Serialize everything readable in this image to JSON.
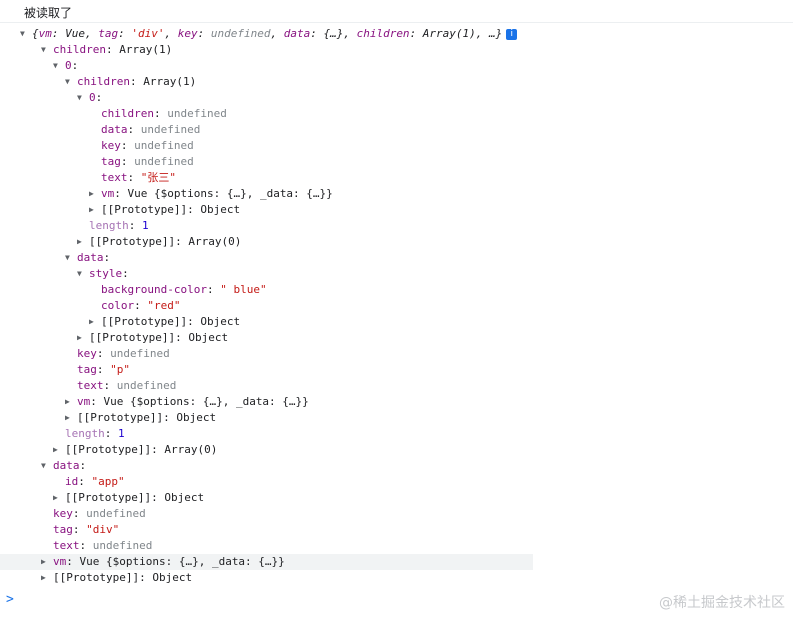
{
  "log_message": "被读取了",
  "watermark": "@稀土掘金技术社区",
  "prompt_symbol": ">",
  "rows": [
    {
      "id": "root",
      "indent": 32,
      "tri": "▼",
      "parts": [
        {
          "t": "{",
          "c": "p it"
        },
        {
          "t": "vm",
          "c": "k it"
        },
        {
          "t": ": Vue, ",
          "c": "p it"
        },
        {
          "t": "tag",
          "c": "k it"
        },
        {
          "t": ": ",
          "c": "p it"
        },
        {
          "t": "'div'",
          "c": "s it"
        },
        {
          "t": ", ",
          "c": "p it"
        },
        {
          "t": "key",
          "c": "k it"
        },
        {
          "t": ": ",
          "c": "p it"
        },
        {
          "t": "undefined",
          "c": "u it"
        },
        {
          "t": ", ",
          "c": "p it"
        },
        {
          "t": "data",
          "c": "k it"
        },
        {
          "t": ": {…}, ",
          "c": "p it"
        },
        {
          "t": "children",
          "c": "k it"
        },
        {
          "t": ": Array(1), …}",
          "c": "p it"
        }
      ],
      "info": "i"
    },
    {
      "id": "r1",
      "indent": 53,
      "tri": "▼",
      "parts": [
        {
          "t": "children",
          "c": "k"
        },
        {
          "t": ": Array(1)",
          "c": "p"
        }
      ]
    },
    {
      "id": "r2",
      "indent": 65,
      "tri": "▼",
      "parts": [
        {
          "t": "0",
          "c": "k"
        },
        {
          "t": ":",
          "c": "p"
        }
      ]
    },
    {
      "id": "r3",
      "indent": 77,
      "tri": "▼",
      "parts": [
        {
          "t": "children",
          "c": "k"
        },
        {
          "t": ": Array(1)",
          "c": "p"
        }
      ]
    },
    {
      "id": "r4",
      "indent": 89,
      "tri": "▼",
      "parts": [
        {
          "t": "0",
          "c": "k"
        },
        {
          "t": ":",
          "c": "p"
        }
      ]
    },
    {
      "id": "r5",
      "indent": 101,
      "parts": [
        {
          "t": "children",
          "c": "k"
        },
        {
          "t": ": ",
          "c": "p"
        },
        {
          "t": "undefined",
          "c": "u"
        }
      ]
    },
    {
      "id": "r6",
      "indent": 101,
      "parts": [
        {
          "t": "data",
          "c": "k"
        },
        {
          "t": ": ",
          "c": "p"
        },
        {
          "t": "undefined",
          "c": "u"
        }
      ]
    },
    {
      "id": "r7",
      "indent": 101,
      "parts": [
        {
          "t": "key",
          "c": "k"
        },
        {
          "t": ": ",
          "c": "p"
        },
        {
          "t": "undefined",
          "c": "u"
        }
      ]
    },
    {
      "id": "r8",
      "indent": 101,
      "parts": [
        {
          "t": "tag",
          "c": "k"
        },
        {
          "t": ": ",
          "c": "p"
        },
        {
          "t": "undefined",
          "c": "u"
        }
      ]
    },
    {
      "id": "r9",
      "indent": 101,
      "parts": [
        {
          "t": "text",
          "c": "k"
        },
        {
          "t": ": ",
          "c": "p"
        },
        {
          "t": "\"张三\"",
          "c": "s"
        }
      ]
    },
    {
      "id": "r10",
      "indent": 101,
      "tri": "▶",
      "parts": [
        {
          "t": "vm",
          "c": "k"
        },
        {
          "t": ": Vue {$options: {…}, _data: {…}}",
          "c": "p"
        }
      ]
    },
    {
      "id": "r11",
      "indent": 101,
      "tri": "▶",
      "parts": [
        {
          "t": "[[Prototype]]",
          "c": "p"
        },
        {
          "t": ": Object",
          "c": "p"
        }
      ]
    },
    {
      "id": "r12",
      "indent": 89,
      "parts": [
        {
          "t": "length",
          "c": "k light"
        },
        {
          "t": ": ",
          "c": "p"
        },
        {
          "t": "1",
          "c": "n"
        }
      ]
    },
    {
      "id": "r13",
      "indent": 89,
      "tri": "▶",
      "parts": [
        {
          "t": "[[Prototype]]",
          "c": "p"
        },
        {
          "t": ": Array(0)",
          "c": "p"
        }
      ]
    },
    {
      "id": "r14",
      "indent": 77,
      "tri": "▼",
      "parts": [
        {
          "t": "data",
          "c": "k"
        },
        {
          "t": ":",
          "c": "p"
        }
      ]
    },
    {
      "id": "r15",
      "indent": 89,
      "tri": "▼",
      "parts": [
        {
          "t": "style",
          "c": "k"
        },
        {
          "t": ":",
          "c": "p"
        }
      ]
    },
    {
      "id": "r16",
      "indent": 101,
      "parts": [
        {
          "t": "background-color",
          "c": "k"
        },
        {
          "t": ": ",
          "c": "p"
        },
        {
          "t": "\" blue\"",
          "c": "s"
        }
      ]
    },
    {
      "id": "r17",
      "indent": 101,
      "parts": [
        {
          "t": "color",
          "c": "k"
        },
        {
          "t": ": ",
          "c": "p"
        },
        {
          "t": "\"red\"",
          "c": "s"
        }
      ]
    },
    {
      "id": "r18",
      "indent": 101,
      "tri": "▶",
      "parts": [
        {
          "t": "[[Prototype]]",
          "c": "p"
        },
        {
          "t": ": Object",
          "c": "p"
        }
      ]
    },
    {
      "id": "r19",
      "indent": 89,
      "tri": "▶",
      "parts": [
        {
          "t": "[[Prototype]]",
          "c": "p"
        },
        {
          "t": ": Object",
          "c": "p"
        }
      ]
    },
    {
      "id": "r20",
      "indent": 77,
      "parts": [
        {
          "t": "key",
          "c": "k"
        },
        {
          "t": ": ",
          "c": "p"
        },
        {
          "t": "undefined",
          "c": "u"
        }
      ]
    },
    {
      "id": "r21",
      "indent": 77,
      "parts": [
        {
          "t": "tag",
          "c": "k"
        },
        {
          "t": ": ",
          "c": "p"
        },
        {
          "t": "\"p\"",
          "c": "s"
        }
      ]
    },
    {
      "id": "r22",
      "indent": 77,
      "parts": [
        {
          "t": "text",
          "c": "k"
        },
        {
          "t": ": ",
          "c": "p"
        },
        {
          "t": "undefined",
          "c": "u"
        }
      ]
    },
    {
      "id": "r23",
      "indent": 77,
      "tri": "▶",
      "parts": [
        {
          "t": "vm",
          "c": "k"
        },
        {
          "t": ": Vue {$options: {…}, _data: {…}}",
          "c": "p"
        }
      ]
    },
    {
      "id": "r24",
      "indent": 77,
      "tri": "▶",
      "parts": [
        {
          "t": "[[Prototype]]",
          "c": "p"
        },
        {
          "t": ": Object",
          "c": "p"
        }
      ]
    },
    {
      "id": "r25",
      "indent": 65,
      "parts": [
        {
          "t": "length",
          "c": "k light"
        },
        {
          "t": ": ",
          "c": "p"
        },
        {
          "t": "1",
          "c": "n"
        }
      ]
    },
    {
      "id": "r26",
      "indent": 65,
      "tri": "▶",
      "parts": [
        {
          "t": "[[Prototype]]",
          "c": "p"
        },
        {
          "t": ": Array(0)",
          "c": "p"
        }
      ]
    },
    {
      "id": "r27",
      "indent": 53,
      "tri": "▼",
      "parts": [
        {
          "t": "data",
          "c": "k"
        },
        {
          "t": ":",
          "c": "p"
        }
      ]
    },
    {
      "id": "r28",
      "indent": 65,
      "parts": [
        {
          "t": "id",
          "c": "k"
        },
        {
          "t": ": ",
          "c": "p"
        },
        {
          "t": "\"app\"",
          "c": "s"
        }
      ]
    },
    {
      "id": "r29",
      "indent": 65,
      "tri": "▶",
      "parts": [
        {
          "t": "[[Prototype]]",
          "c": "p"
        },
        {
          "t": ": Object",
          "c": "p"
        }
      ]
    },
    {
      "id": "r30",
      "indent": 53,
      "parts": [
        {
          "t": "key",
          "c": "k"
        },
        {
          "t": ": ",
          "c": "p"
        },
        {
          "t": "undefined",
          "c": "u"
        }
      ]
    },
    {
      "id": "r31",
      "indent": 53,
      "parts": [
        {
          "t": "tag",
          "c": "k"
        },
        {
          "t": ": ",
          "c": "p"
        },
        {
          "t": "\"div\"",
          "c": "s"
        }
      ]
    },
    {
      "id": "r32",
      "indent": 53,
      "parts": [
        {
          "t": "text",
          "c": "k"
        },
        {
          "t": ": ",
          "c": "p"
        },
        {
          "t": "undefined",
          "c": "u"
        }
      ]
    },
    {
      "id": "r33",
      "indent": 53,
      "tri": "▶",
      "parts": [
        {
          "t": "vm",
          "c": "k"
        },
        {
          "t": ": Vue {$options: {…}, _data: {…}}",
          "c": "p"
        }
      ]
    },
    {
      "id": "r34",
      "indent": 53,
      "tri": "▶",
      "parts": [
        {
          "t": "[[Prototype]]",
          "c": "p"
        },
        {
          "t": ": Object",
          "c": "p"
        }
      ]
    }
  ]
}
